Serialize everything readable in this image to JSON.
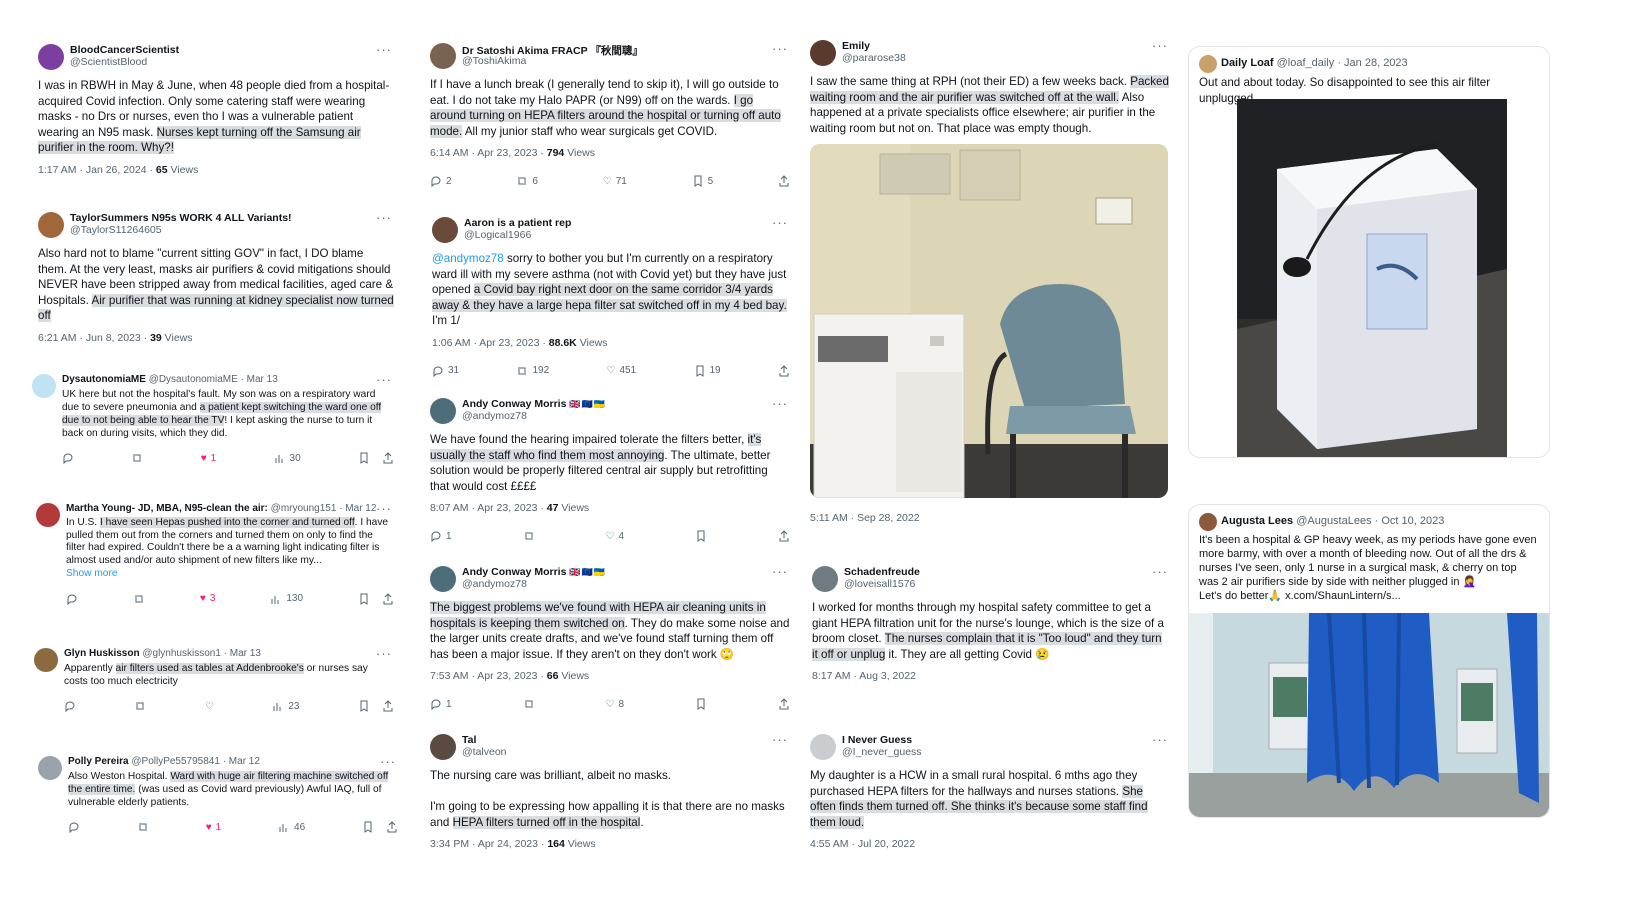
{
  "col1": [
    {
      "name": "BloodCancerScientist",
      "handle": "@ScientistBlood",
      "body_plain": "I was in RBWH in May & June, when 48 people died from a hospital-acquired Covid infection. Only some catering staff were wearing masks - no Drs or nurses, even tho I was a vulnerable patient wearing an N95 mask. ",
      "body_hl": "Nurses kept turning off the Samsung air purifier in the room. Why?!",
      "time": "1:17 AM · Jan 26, 2024 · ",
      "views": "65",
      "views_label": " Views"
    },
    {
      "name": "TaylorSummers N95s WORK 4 ALL Variants!",
      "handle": "@TaylorS11264605",
      "body_plain": "Also hard not to blame \"current sitting GOV\" in fact, I DO blame them. At the very least, masks air purifiers & covid mitigations should NEVER have been stripped away from medical facilities, aged care & Hospitals. ",
      "body_hl": "Air purifier that was running at kidney specialist now turned off",
      "time": "6:21 AM · Jun 8, 2023 · ",
      "views": "39",
      "views_label": " Views"
    },
    {
      "name": "DysautonomiaME",
      "handle_inline": "@DysautonomiaME · Mar 13",
      "body_plain": "UK here but not the hospital's fault. My son was on a respiratory ward due to severe pneumonia and ",
      "body_hl": "a patient kept switching the ward one off due to not being able to hear the TV",
      "body_plain2": "! I kept asking the nurse to turn it back on during visits, which they did.",
      "likes": "1",
      "analytics": "30"
    },
    {
      "name": "Martha Young- JD, MBA, N95-clean the air:",
      "handle_inline": "@mryoung151 · Mar 12",
      "body_plain": "In U.S. ",
      "body_hl": "I have seen Hepas pushed into the corner and turned off",
      "body_plain2": ". I have pulled them out from the corners and turned them on only to find the filter had expired. Couldn't there be a a warning light indicating filter is almost used and/or auto shipment of new filters like my...",
      "show_more": "Show more",
      "likes": "3",
      "analytics": "130"
    },
    {
      "name": "Glyn Huskisson",
      "handle_inline": "@glynhuskisson1 · Mar 13",
      "body_plain": "Apparently ",
      "body_hl": "air filters used as tables at Addenbrooke's",
      "body_plain2": " or nurses say costs too much electricity",
      "analytics": "23"
    },
    {
      "name": "Polly Pereira",
      "handle_inline": "@PollyPe55795841 · Mar 12",
      "body_plain": "Also Weston Hospital. ",
      "body_hl": "Ward with huge air filtering machine switched off the entire time.",
      "body_plain2": " (was used as Covid ward previously) Awful IAQ, full of vulnerable elderly patients.",
      "likes": "1",
      "analytics": "46"
    }
  ],
  "col2": [
    {
      "name": "Dr Satoshi Akima FRACP 『秋間聰』",
      "handle": "@ToshiAkima",
      "body_plain": "If I have a lunch break (I generally tend to skip it), I will go outside to eat. I do not take my Halo PAPR (or N99) off on the wards. ",
      "body_hl": "I go around turning on HEPA filters around the hospital or turning off auto mode.",
      "body_plain2": " All my junior staff who wear surgicals get COVID.",
      "time": "6:14 AM · Apr 23, 2023 · ",
      "views": "794",
      "views_label": " Views",
      "replies": "2",
      "retweets": "6",
      "likes": "71",
      "bookmarks": "5"
    },
    {
      "name": "Aaron is a patient rep",
      "handle": "@Logical1966",
      "mention": "@andymoz78",
      "body_plain": " sorry to bother you but I'm currently on a respiratory ward ill with my severe asthma (not with Covid yet) but they have just opened ",
      "body_hl": "a Covid bay right next door on the same corridor 3/4 yards away & they have a large hepa filter sat switched off in my 4 bed bay.",
      "body_plain2": " I'm 1/",
      "time": "1:06 AM · Apr 23, 2023 · ",
      "views": "88.6K",
      "views_label": " Views",
      "replies": "31",
      "retweets": "192",
      "likes": "451",
      "bookmarks": "19"
    },
    {
      "name": "Andy Conway Morris",
      "flags": "🇬🇧🇪🇺🇺🇦",
      "handle": "@andymoz78",
      "body_plain": "We have found the hearing impaired tolerate the filters better, ",
      "body_hl": "it's usually the staff who find them most annoying",
      "body_plain2": ". The ultimate, better solution would be properly filtered central air supply but retrofitting that would cost ££££",
      "time": "8:07 AM · Apr 23, 2023 · ",
      "views": "47",
      "views_label": " Views",
      "replies": "1",
      "likes": "4"
    },
    {
      "name": "Andy Conway Morris",
      "flags": "🇬🇧🇪🇺🇺🇦",
      "handle": "@andymoz78",
      "body_hl": "The biggest problems we've found with HEPA air cleaning units in hospitals is keeping them switched on",
      "body_plain2": ". They do make some noise and the larger units create drafts, and we've found staff turning them off has been a major issue. If they aren't on they don't work 🙄",
      "time": "7:53 AM · Apr 23, 2023 · ",
      "views": "66",
      "views_label": " Views",
      "replies": "1",
      "likes": "8"
    },
    {
      "name": "Tal",
      "handle": "@talveon",
      "body_plain": "The nursing care was brilliant, albeit no masks.",
      "body_plain_b": "I'm going to be expressing how appalling it is that there are no masks and ",
      "body_hl": "HEPA filters turned off in the hospital",
      "body_plain2": ".",
      "time": "3:34 PM · Apr 24, 2023 · ",
      "views": "164",
      "views_label": " Views"
    }
  ],
  "col3": [
    {
      "name": "Emily",
      "handle": "@pararose38",
      "body_plain": "I saw the same thing at RPH (not their ED) a few weeks back. ",
      "body_hl": "Packed waiting room and the air purifier was switched off at the wall.",
      "body_plain2": " Also happened at a private specialists office elsewhere; air purifier in the waiting room but not on. That place was empty though.",
      "time": "5:11 AM · Sep 28, 2022"
    },
    {
      "name": "Schadenfreude",
      "handle": "@loveisall1576",
      "body_plain": "I worked for months through my hospital safety committee to get a giant HEPA filtration unit for the nurse's lounge, which is the size of a broom closet. ",
      "body_hl": "The nurses complain that it is \"Too loud\" and they turn it off or unplug",
      "body_plain2": " it. They are all getting Covid 😢",
      "time": "8:17 AM · Aug 3, 2022"
    },
    {
      "name": "I Never Guess",
      "handle": "@I_never_guess",
      "body_plain": "My daughter is a HCW in a small rural hospital. 6 mths ago they purchased HEPA filters for the hallways and nurses stations. ",
      "body_hl": "She often finds them turned off. She thinks it's because some staff find them loud.",
      "time": "4:55 AM · Jul 20, 2022"
    }
  ],
  "col4": [
    {
      "name": "Daily Loaf",
      "handle_inline": "@loaf_daily · Jan 28, 2023",
      "body_plain": "Out and about today. So disappointed to see this air filter unplugged."
    },
    {
      "name": "Augusta Lees",
      "handle_inline": "@AugustaLees · Oct 10, 2023",
      "body_plain": "It's been a hospital & GP heavy week, as my periods have gone even more barmy, with over a month of bleeding now. Out of all the drs & nurses I've seen, only 1 nurse in a surgical mask, & cherry on top was 2 air purifiers side by side with neither plugged in 🤦‍♀️",
      "body_plain2": "Let's do better🙏 x.com/ShaunLintern/s..."
    }
  ],
  "more_glyph": "···"
}
